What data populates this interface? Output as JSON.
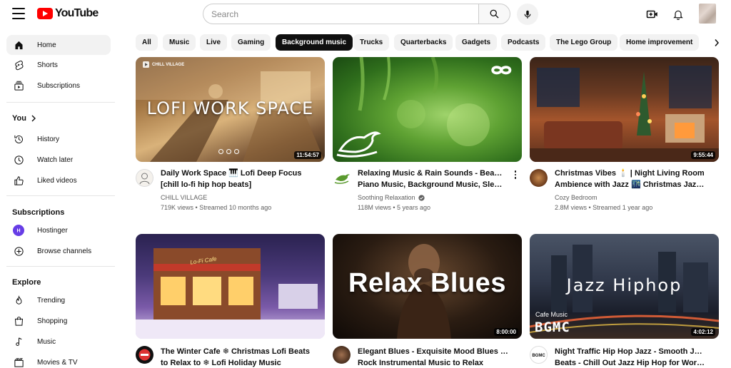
{
  "header": {
    "logo_text": "YouTube",
    "search_placeholder": "Search"
  },
  "sidebar": {
    "items": [
      {
        "label": "Home",
        "icon": "home-icon"
      },
      {
        "label": "Shorts",
        "icon": "shorts-icon"
      },
      {
        "label": "Subscriptions",
        "icon": "subscriptions-icon"
      }
    ],
    "you_label": "You",
    "you_items": [
      {
        "label": "History",
        "icon": "history-icon"
      },
      {
        "label": "Watch later",
        "icon": "clock-icon"
      },
      {
        "label": "Liked videos",
        "icon": "thumbs-up-icon"
      }
    ],
    "subscriptions_heading": "Subscriptions",
    "subscription_items": [
      {
        "label": "Hostinger",
        "icon": "hostinger-avatar"
      },
      {
        "label": "Browse channels",
        "icon": "add-circle-icon"
      }
    ],
    "explore_heading": "Explore",
    "explore_items": [
      {
        "label": "Trending",
        "icon": "fire-icon"
      },
      {
        "label": "Shopping",
        "icon": "shopping-bag-icon"
      },
      {
        "label": "Music",
        "icon": "music-note-icon"
      },
      {
        "label": "Movies & TV",
        "icon": "film-icon"
      }
    ]
  },
  "chips": [
    "All",
    "Music",
    "Live",
    "Gaming",
    "Background music",
    "Trucks",
    "Quarterbacks",
    "Gadgets",
    "Podcasts",
    "The Lego Group",
    "Home improvement"
  ],
  "active_chip": "Background music",
  "videos": [
    {
      "title_line1": "Daily Work Space 🎹 Lofi Deep Focus",
      "title_line2": "[chill lo-fi hip hop beats]",
      "channel": "CHILL VILLAGE",
      "verified": false,
      "views": "719K views",
      "age": "Streamed 10 months ago",
      "duration": "11:54:57",
      "thumb_text": "LOFI WORK SPACE",
      "thumb_badge": "CHILL VILLAGE"
    },
    {
      "title_line1": "Relaxing Music & Rain Sounds - Beautiful",
      "title_line2": "Piano Music, Background Music, Sleep...",
      "channel": "Soothing Relaxation",
      "verified": true,
      "views": "118M views",
      "age": "5 years ago",
      "duration": "",
      "thumb_text": ""
    },
    {
      "title_line1": "Christmas Vibes 🕯️ | Night Living Room",
      "title_line2": "Ambience with Jazz 🌃 Christmas Jazz...",
      "channel": "Cozy Bedroom",
      "verified": false,
      "views": "2.8M views",
      "age": "Streamed 1 year ago",
      "duration": "9:55:44",
      "thumb_text": ""
    },
    {
      "title_line1": "The Winter Cafe ❄ Christmas Lofi Beats",
      "title_line2": "to Relax to ❄ Lofi Holiday Music",
      "channel": "",
      "verified": false,
      "views": "",
      "age": "",
      "duration": "",
      "thumb_text": "Lo-Fi Cafe"
    },
    {
      "title_line1": "Elegant Blues - Exquisite Mood Blues and",
      "title_line2": "Rock Instrumental Music to Relax",
      "channel": "",
      "verified": false,
      "views": "",
      "age": "",
      "duration": "8:00:00",
      "thumb_text": "Relax Blues"
    },
    {
      "title_line1": "Night Traffic Hip Hop Jazz - Smooth Jazz",
      "title_line2": "Beats - Chill Out Jazz Hip Hop for Work ...",
      "channel": "",
      "verified": false,
      "views": "",
      "age": "",
      "duration": "4:02:12",
      "thumb_text": "Jazz Hiphop",
      "thumb_sub1": "Cafe Music",
      "thumb_sub2": "BGMC"
    }
  ],
  "colors": {
    "brand_red": "#ff0000",
    "chip_bg": "#f2f2f2",
    "chip_active_bg": "#0f0f0f",
    "meta_text": "#606060"
  }
}
